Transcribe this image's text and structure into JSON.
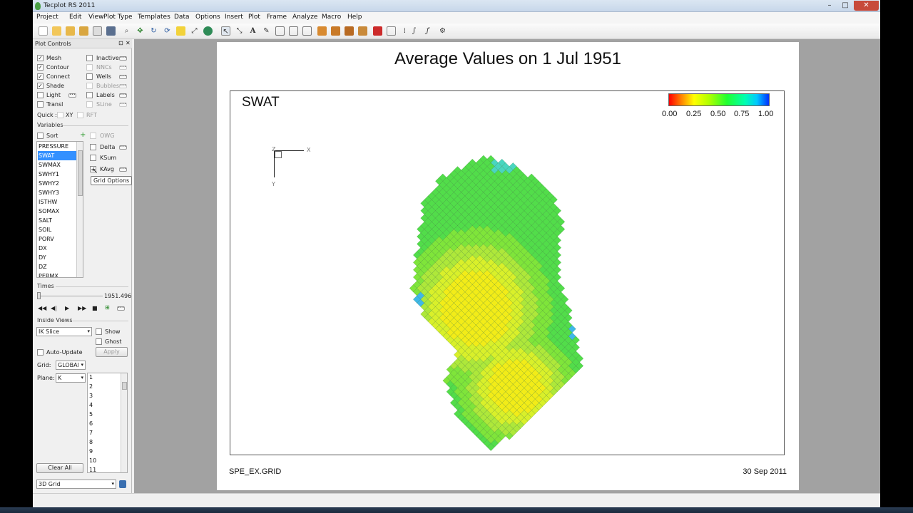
{
  "window": {
    "title": "Tecplot RS 2011",
    "min": "–",
    "max": "□",
    "close": "✕"
  },
  "menu": [
    "Project",
    "Edit",
    "View",
    "Plot Type",
    "Templates",
    "Data",
    "Options",
    "Insert",
    "Plot",
    "Frame",
    "Analyze",
    "Macro",
    "Help"
  ],
  "panel": {
    "title": "Plot Controls",
    "layers_left": [
      {
        "label": "Mesh",
        "checked": true
      },
      {
        "label": "Contour",
        "checked": true
      },
      {
        "label": "Connect",
        "checked": true
      },
      {
        "label": "Shade",
        "checked": true
      },
      {
        "label": "Light",
        "checked": false
      },
      {
        "label": "Transl",
        "checked": false
      }
    ],
    "layers_right": [
      {
        "label": "Inactive",
        "checked": false,
        "enabled": true
      },
      {
        "label": "NNCs",
        "checked": false,
        "enabled": false
      },
      {
        "label": "Wells",
        "checked": false,
        "enabled": true
      },
      {
        "label": "Bubbles",
        "checked": false,
        "enabled": false
      },
      {
        "label": "Labels",
        "checked": false,
        "enabled": true
      },
      {
        "label": "SLine",
        "checked": false,
        "enabled": false
      }
    ],
    "quick_label": "Quick :",
    "quick_xy": "XY",
    "quick_rft": "RFT",
    "variables_label": "Variables",
    "sort_label": "Sort",
    "owg_label": "OWG",
    "variables": [
      "PRESSURE",
      "SWAT",
      "SWMAX",
      "SWHY1",
      "SWHY2",
      "SWHY3",
      "ISTHW",
      "SOMAX",
      "SALT",
      "SOIL",
      "PORV",
      "DX",
      "DY",
      "DZ",
      "PERMX"
    ],
    "selected_variable": "SWAT",
    "var_options": [
      {
        "label": "Delta",
        "checked": false
      },
      {
        "label": "KSum",
        "checked": false
      },
      {
        "label": "KAvg",
        "checked": true
      }
    ],
    "tooltip": "Grid Options",
    "times_label": "Times",
    "time_value": "1951.496",
    "inside_views_label": "Inside Views",
    "slice_select": "IK Slice",
    "show_label": "Show",
    "ghost_label": "Ghost",
    "auto_update_label": "Auto-Update",
    "apply_label": "Apply",
    "grid_label": "Grid:",
    "grid_select": "GLOBAl",
    "plane_label": "Plane:",
    "plane_select": "K",
    "planes": [
      "1",
      "2",
      "3",
      "4",
      "5",
      "6",
      "7",
      "8",
      "9",
      "10",
      "11"
    ],
    "clear_all_label": "Clear All",
    "view_select": "3D Grid"
  },
  "plot": {
    "title": "Average Values on 1 Jul 1951",
    "variable": "SWAT",
    "colorbar_ticks": [
      "0.00",
      "0.25",
      "0.50",
      "0.75",
      "1.00"
    ],
    "axis_x": "X",
    "axis_y": "Y",
    "axis_z": "Z",
    "footer_left": "SPE_EX.GRID",
    "footer_right": "30 Sep 2011"
  }
}
